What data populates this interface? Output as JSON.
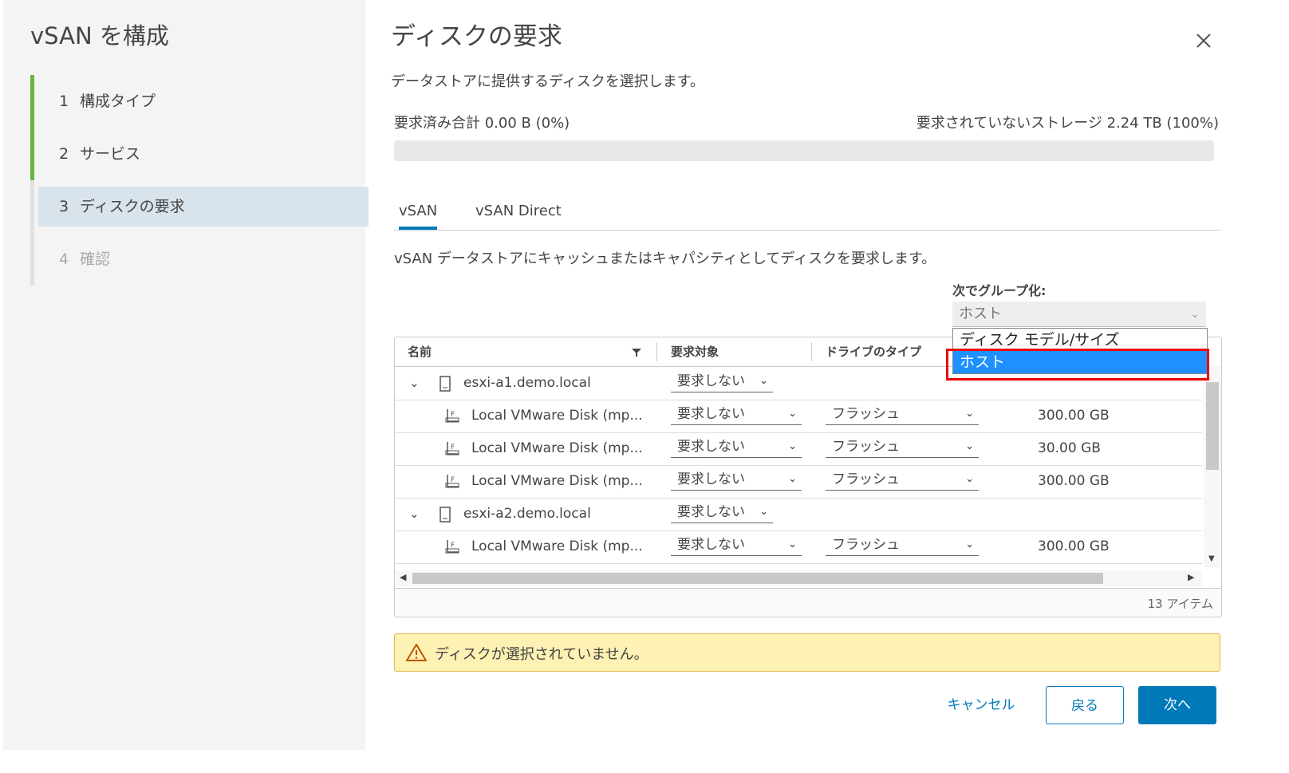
{
  "wizard": {
    "title": "vSAN を構成",
    "steps": [
      {
        "num": "1",
        "label": "構成タイプ"
      },
      {
        "num": "2",
        "label": "サービス"
      },
      {
        "num": "3",
        "label": "ディスクの要求"
      },
      {
        "num": "4",
        "label": "確認"
      }
    ]
  },
  "dialog": {
    "title": "ディスクの要求",
    "subtitle": "データストアに提供するディスクを選択します。",
    "claimed": "要求済み合計 0.00 B (0%)",
    "unclaimed": "要求されていないストレージ 2.24 TB (100%)",
    "progress_fraction": 0
  },
  "tabs": [
    "vSAN",
    "vSAN Direct"
  ],
  "tab_description": "vSAN データストアにキャッシュまたはキャパシティとしてディスクを要求します。",
  "group_by": {
    "label": "次でグループ化:",
    "value": "ホスト",
    "options": [
      "ディスク モデル/サイズ",
      "ホスト"
    ],
    "selected_index": 1
  },
  "grid": {
    "columns": [
      "名前",
      "要求対象",
      "ドライブのタイプ"
    ],
    "rows": [
      {
        "type": "host",
        "name": "esxi-a1.demo.local",
        "claim": "要求しない"
      },
      {
        "type": "disk",
        "name": "Local VMware Disk (mp...",
        "claim": "要求しない",
        "drive": "フラッシュ",
        "size": "300.00 GB"
      },
      {
        "type": "disk",
        "name": "Local VMware Disk (mp...",
        "claim": "要求しない",
        "drive": "フラッシュ",
        "size": "30.00 GB"
      },
      {
        "type": "disk",
        "name": "Local VMware Disk (mp...",
        "claim": "要求しない",
        "drive": "フラッシュ",
        "size": "300.00 GB"
      },
      {
        "type": "host",
        "name": "esxi-a2.demo.local",
        "claim": "要求しない"
      },
      {
        "type": "disk",
        "name": "Local VMware Disk (mp...",
        "claim": "要求しない",
        "drive": "フラッシュ",
        "size": "300.00 GB"
      }
    ],
    "item_count": "13 アイテム"
  },
  "alert": "ディスクが選択されていません。",
  "buttons": {
    "cancel": "キャンセル",
    "back": "戻る",
    "next": "次へ"
  }
}
